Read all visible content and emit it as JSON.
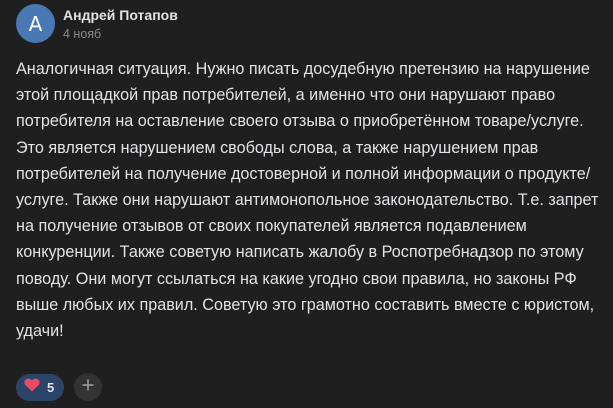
{
  "comment": {
    "avatar_letter": "А",
    "author": "Андрей Потапов",
    "date": "4 нояб",
    "text": "Аналогичная ситуация. Нужно писать досудебную претензию на нарушение этой площадкой прав потребителей, а именно что они нарушают право потребителя на оставление своего отзыва о приобретённом товаре/услуге. Это является нарушением свободы слова, а также нарушением прав потребителей на получение достоверной и полной информации о продукте/услуге. Также они нарушают антимонопольное законодательство. Т.е. запрет на получение отзывов от своих покупателей является подавлением конкуренции. Также советую написать жалобу в Роспотребнадзор по этому поводу. Они могут ссылаться на какие угодно свои правила, но законы РФ выше любых их правил. Советую это грамотно составить вместе с юристом, удачи!"
  },
  "reactions": {
    "heart": {
      "icon": "heart-icon",
      "count": "5",
      "color": "#e64c66"
    },
    "add": {
      "icon": "plus-icon"
    }
  },
  "colors": {
    "background": "#1f1f1f",
    "avatar": "#4a78b4",
    "pill": "#2d4469",
    "text": "#e1e3e6",
    "muted": "#8a8a8e"
  }
}
